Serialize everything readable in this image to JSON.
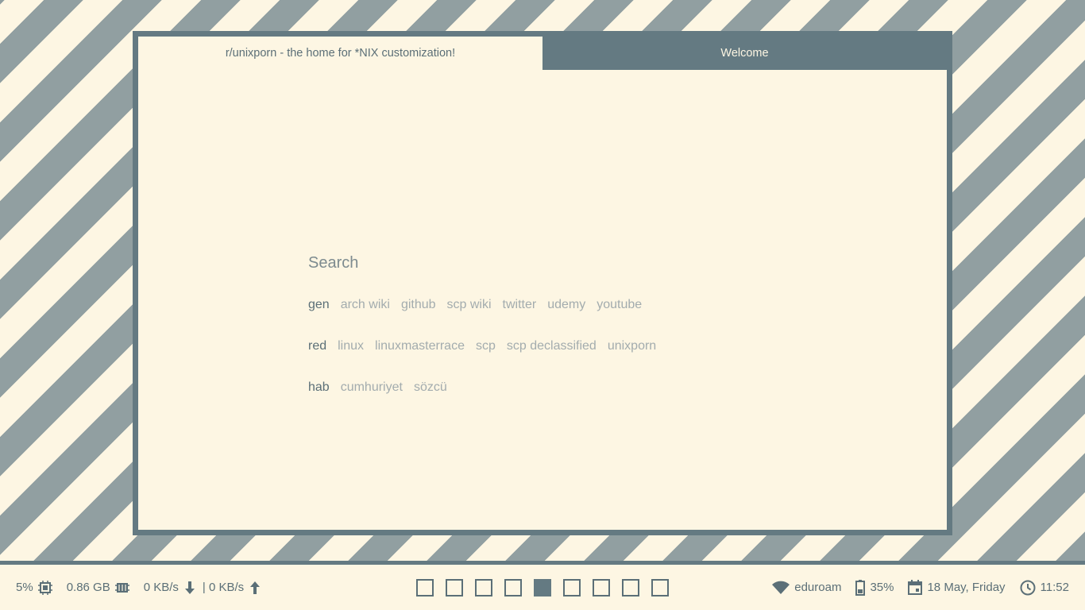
{
  "browser": {
    "tabs": [
      {
        "label": "r/unixporn - the home for *NIX customization!",
        "active": true
      },
      {
        "label": "Welcome",
        "active": false
      }
    ]
  },
  "startpage": {
    "search_placeholder": "Search",
    "groups": [
      {
        "category": "gen",
        "links": [
          "arch wiki",
          "github",
          "scp wiki",
          "twitter",
          "udemy",
          "youtube"
        ]
      },
      {
        "category": "red",
        "links": [
          "linux",
          "linuxmasterrace",
          "scp",
          "scp declassified",
          "unixporn"
        ]
      },
      {
        "category": "hab",
        "links": [
          "cumhuriyet",
          "sözcü"
        ]
      }
    ]
  },
  "bar": {
    "cpu": "5%",
    "cpu_icon": "cpu-icon",
    "memory": "0.86 GB",
    "memory_icon": "memory-icon",
    "net_down": "0 KB/s",
    "net_up": "| 0 KB/s",
    "workspaces": {
      "count": 9,
      "active_index": 4
    },
    "wifi": "eduroam",
    "battery": "35%",
    "date": "18 May, Friday",
    "time": "11:52"
  },
  "colors": {
    "background_light": "#fdf6e3",
    "stripe": "#919fa1",
    "accent": "#647a82",
    "text_dark": "#5b6f77",
    "link": "#a3acae"
  }
}
